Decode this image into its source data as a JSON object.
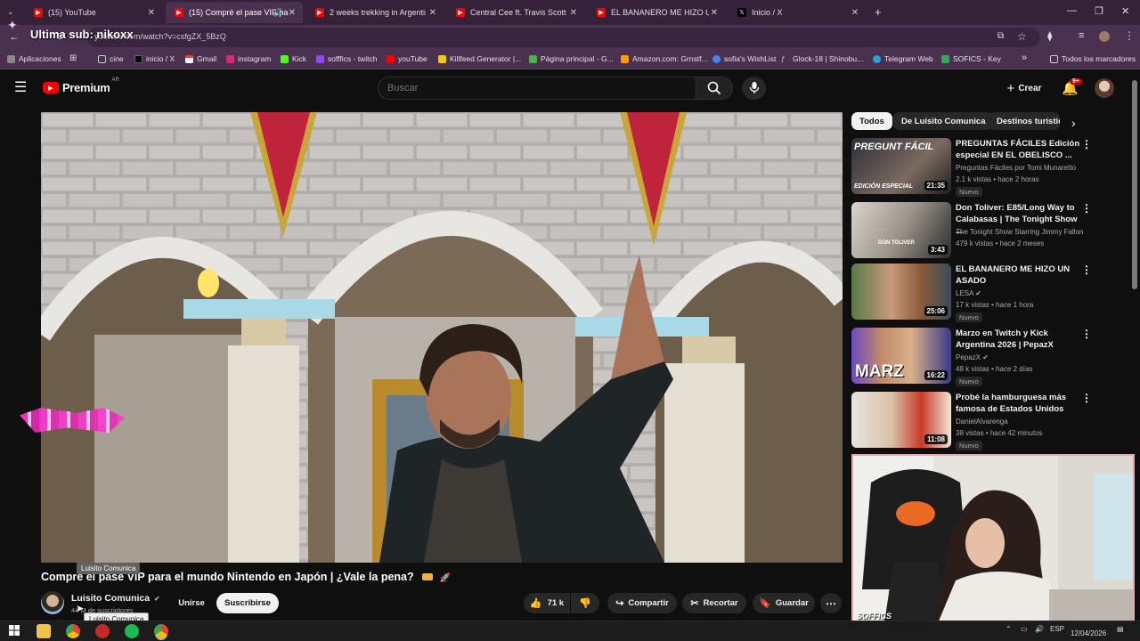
{
  "browser": {
    "tabs": [
      {
        "label": "(15) YouTube",
        "color": "#ff0000"
      },
      {
        "label": "(15) Compré el pase VIP pa",
        "color": "#ff0000",
        "active": true
      },
      {
        "label": "2 weeks trekking in Argentina &",
        "color": "#ff0000"
      },
      {
        "label": "Central Cee ft. Travis Scott - Mo",
        "color": "#ff0000"
      },
      {
        "label": "EL BANANERO ME HIZO UN AS",
        "color": "#ff0000"
      },
      {
        "label": "Inicio / X",
        "color": "#000000"
      }
    ],
    "url": "youtube.com/watch?v=csfgZX_5BzQ",
    "overlay_text": "Ultima sub: nikoxx",
    "bookmarks": [
      {
        "label": "Aplicaciones",
        "color": "#888888"
      },
      {
        "label": "cine",
        "color": "#aaaaaa"
      },
      {
        "label": "inicio / X",
        "color": "#000000"
      },
      {
        "label": "Gmail",
        "color": "#ffffff"
      },
      {
        "label": "instagram",
        "color": "#d62976"
      },
      {
        "label": "Kick",
        "color": "#53fc18"
      },
      {
        "label": "sofffics - twitch",
        "color": "#9146ff"
      },
      {
        "label": "youTube",
        "color": "#ff0000"
      },
      {
        "label": "Killfeed Generator |...",
        "color": "#f5c518"
      },
      {
        "label": "Página principal - G...",
        "color": "#4caf50"
      },
      {
        "label": "Amazon.com: Grnstf...",
        "color": "#ff9900"
      },
      {
        "label": "sofia's WishList",
        "color": "#4285f4"
      },
      {
        "label": "Glock-18 | Shinobu...",
        "color": "#cccccc"
      },
      {
        "label": "Telegram Web",
        "color": "#2aa1da"
      },
      {
        "label": "SOFICS - Key",
        "color": "#34a853"
      },
      {
        "label": "Todos los marcadores",
        "color": "#aaaaaa"
      }
    ]
  },
  "youtube": {
    "logo_text": "Premium",
    "region": "AR",
    "search_placeholder": "Buscar",
    "create_label": "Crear",
    "notif_count": "9+",
    "chips": [
      "Todos",
      "De Luisito Comunica",
      "Destinos turístic"
    ],
    "video_title": "Compré el pase VIP para el mundo Nintendo en Japón | ¿Vale la pena?",
    "channel": "Luisito Comunica",
    "subscribers": "44 M de suscriptores",
    "tooltip_top": "Luisito Comunica",
    "tooltip_bottom": "Luisito Comunica",
    "join_label": "Unirse",
    "subscribe_label": "Suscribirse",
    "likes": "71 k",
    "share_label": "Compartir",
    "clip_label": "Recortar",
    "save_label": "Guardar",
    "recommendations": [
      {
        "title": "PREGUNTAS FÁCILES Edición especial EN EL OBELISCO ...",
        "channel": "Preguntas Fáciles por Tomi Munaretto",
        "meta": "2.1 k vistas • hace 2 horas",
        "badge": "Nuevo",
        "duration": "21:35",
        "thumb_text": "PREGUNT FÁCIL",
        "thumb_sub": "EDICIÓN ESPECIAL"
      },
      {
        "title": "Don Toliver: E85/Long Way to Calabasas | The Tonight Show ...",
        "channel": "The Tonight Show Starring Jimmy Fallon",
        "meta": "479 k vistas • hace 2 meses",
        "badge": "",
        "duration": "3:43",
        "thumb_text": "DON TOLIVER"
      },
      {
        "title": "EL BANANERO ME HIZO UN ASADO",
        "channel": "LESA",
        "meta": "17 k vistas • hace 1 hora",
        "badge": "Nuevo",
        "duration": "25:06"
      },
      {
        "title": "Marzo en Twitch y Kick Argentina 2026 | PepazX",
        "channel": "PepazX",
        "meta": "48 k vistas • hace 2 días",
        "badge": "Nuevo",
        "duration": "16:22",
        "thumb_text": "MARZ"
      },
      {
        "title": "Probé la hamburguesa más famosa de Estados Unidos",
        "channel": "DanielAlvarenga",
        "meta": "38 vistas • hace 42 minutos",
        "badge": "Nuevo",
        "duration": "11:08"
      }
    ]
  },
  "webcam": {
    "watermark": "SOFFICS"
  },
  "taskbar": {
    "lang": "ESP",
    "date": "12/04/2026"
  }
}
